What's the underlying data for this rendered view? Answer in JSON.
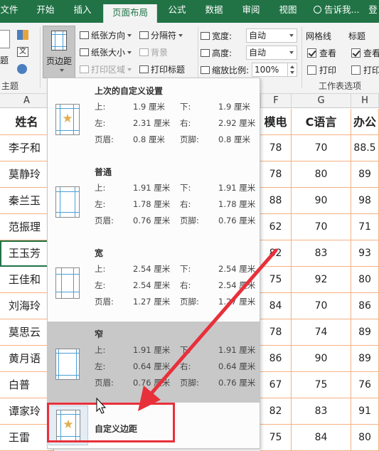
{
  "tabs": [
    {
      "label": "文件",
      "active": false
    },
    {
      "label": "开始",
      "active": false
    },
    {
      "label": "插入",
      "active": false
    },
    {
      "label": "页面布局",
      "active": true
    },
    {
      "label": "公式",
      "active": false
    },
    {
      "label": "数据",
      "active": false
    },
    {
      "label": "审阅",
      "active": false
    },
    {
      "label": "视图",
      "active": false
    }
  ],
  "tell_me": "告诉我...",
  "signin": "登",
  "ribbon": {
    "theme_group_label": "主题",
    "theme_btn_label": "题",
    "margins_btn_label": "页边距",
    "orientation": "纸张方向",
    "size": "纸张大小",
    "print_area": "打印区域",
    "breaks": "分隔符",
    "background": "背景",
    "print_titles": "打印标题",
    "width_label": "宽度:",
    "width_value": "自动",
    "height_label": "高度:",
    "height_value": "自动",
    "scale_label": "缩放比例:",
    "scale_value": "100%",
    "gridlines_label": "网格线",
    "headings_label": "标题",
    "view_label": "查看",
    "print_label": "打印",
    "sheet_options_label": "工作表选项"
  },
  "margins_menu": {
    "presets": [
      {
        "title": "上次的自定义设置",
        "top": "1.9 厘米",
        "bottom": "1.9 厘米",
        "left": "2.31 厘米",
        "right": "2.92 厘米",
        "header": "0.8 厘米",
        "footer": "0.8 厘米",
        "hover": false
      },
      {
        "title": "普通",
        "top": "1.91 厘米",
        "bottom": "1.91 厘米",
        "left": "1.78 厘米",
        "right": "1.78 厘米",
        "header": "0.76 厘米",
        "footer": "0.76 厘米",
        "hover": false
      },
      {
        "title": "宽",
        "top": "2.54 厘米",
        "bottom": "2.54 厘米",
        "left": "2.54 厘米",
        "right": "2.54 厘米",
        "header": "1.27 厘米",
        "footer": "1.27 厘米",
        "hover": false
      },
      {
        "title": "窄",
        "top": "1.91 厘米",
        "bottom": "1.91 厘米",
        "left": "0.64 厘米",
        "right": "0.64 厘米",
        "header": "0.76 厘米",
        "footer": "0.76 厘米",
        "hover": true
      }
    ],
    "labels": {
      "top": "上:",
      "bottom": "下:",
      "left": "左:",
      "right": "右:",
      "header": "页眉:",
      "footer": "页脚:"
    },
    "custom_label": "自定义边距"
  },
  "columns_left": [
    "A"
  ],
  "columns_right": [
    "F",
    "G",
    "H"
  ],
  "sheet": {
    "name_header": "姓名",
    "col_F_header": "模电",
    "col_G_header": "C语言",
    "col_H_header": "办公",
    "rows": [
      {
        "name": "李子和",
        "F": "78",
        "G": "70",
        "H": "88.5"
      },
      {
        "name": "莫静玲",
        "F": "78",
        "G": "80",
        "H": "89"
      },
      {
        "name": "秦兰玉",
        "F": "88",
        "G": "90",
        "H": "98"
      },
      {
        "name": "范振理",
        "F": "62",
        "G": "70",
        "H": "71"
      },
      {
        "name": "王玉芳",
        "F": "82",
        "G": "83",
        "H": "93"
      },
      {
        "name": "王佳和",
        "F": "75",
        "G": "92",
        "H": "80"
      },
      {
        "name": "刘海玲",
        "F": "84",
        "G": "70",
        "H": "86"
      },
      {
        "name": "莫思云",
        "F": "78",
        "G": "74",
        "H": "89"
      },
      {
        "name": "黄月语",
        "F": "86",
        "G": "90",
        "H": "89"
      },
      {
        "name": "白普",
        "F": "67",
        "G": "75",
        "H": "76"
      },
      {
        "name": "谭家玲",
        "F": "82",
        "G": "83",
        "H": "91"
      },
      {
        "name": "王雷",
        "F": "75",
        "G": "84",
        "H": "80"
      }
    ]
  },
  "colors": {
    "brand": "#217346",
    "table_border": "#f4b183",
    "annotation_red": "#e8303a"
  }
}
